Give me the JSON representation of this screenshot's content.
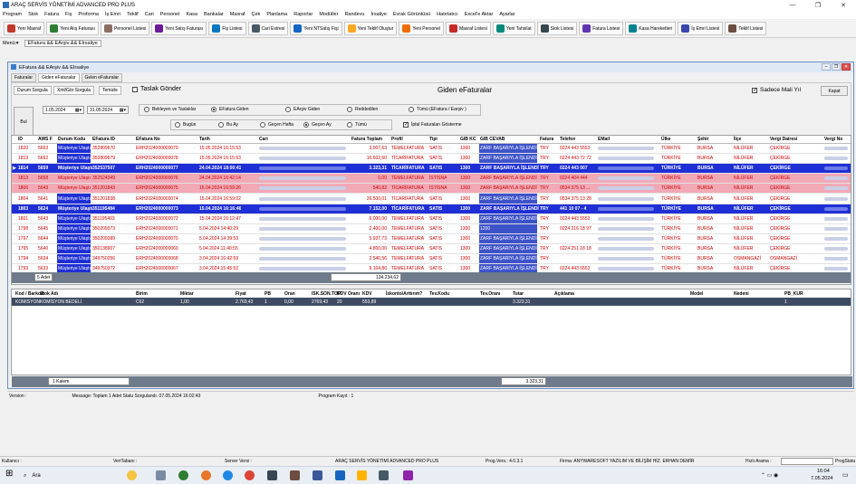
{
  "title": "ARAÇ SERVİS YÖNETİMİ ADVANCED PRO PLUS",
  "menu": [
    "Program",
    "Stok",
    "Fatura",
    "Fiş",
    "Proforma",
    "İş Emri",
    "Teklif",
    "Cari",
    "Personel",
    "Kasa",
    "Bankalar",
    "Masraf",
    "Çek",
    "Planlama",
    "Raporlar",
    "Modüller",
    "Randevu",
    "İrsaliye",
    "Evrak Görüntüsü",
    "Hatırlatıcı",
    "Excel'e Aktar",
    "Ayarlar"
  ],
  "toolbar": [
    {
      "label": "Yeni Masraf",
      "color": "#c0392b"
    },
    {
      "label": "Yeni Alış Faturası",
      "color": "#2e7d32"
    },
    {
      "label": "Personel Listesi",
      "color": "#8d6e63"
    },
    {
      "label": "Yeni Satış Faturası",
      "color": "#6a1b9a"
    },
    {
      "label": "Fiş Listesi",
      "color": "#0277bd"
    },
    {
      "label": "Cari Extresi",
      "color": "#455a64"
    },
    {
      "label": "Yeni NTSatış Fişi",
      "color": "#1565c0"
    },
    {
      "label": "Yeni Teklif Oluştur",
      "color": "#f9a825"
    },
    {
      "label": "Yeni Personel",
      "color": "#ef6c00"
    },
    {
      "label": "Masraf Listesi",
      "color": "#c62828"
    },
    {
      "label": "Yeni Tahsilat",
      "color": "#00897b"
    },
    {
      "label": "Stok Listesi",
      "color": "#37474f"
    },
    {
      "label": "Fatura Listesi",
      "color": "#5e35b1"
    },
    {
      "label": "Kasa Hareketleri",
      "color": "#00838f"
    },
    {
      "label": "İş Emri Listesi",
      "color": "#3949ab"
    },
    {
      "label": "Teklif Listesi",
      "color": "#6d4c41"
    }
  ],
  "subbar": {
    "menu": "Menü",
    "tab": "EFatura && EArşiv && EIrsaliye"
  },
  "window": {
    "title": "EFatura && EArşiv && EIrsaliye",
    "tabs": [
      "Faturalar",
      "Giden eFaturalar",
      "Gelen eFaturalar"
    ],
    "panel_tabs": [
      "Durum Sorgula",
      "Xml/Gör Sorgula",
      "Temizle"
    ],
    "taslak": "Taslak Gönder",
    "heading": "Giden eFaturalar",
    "sadece": "Sadece Mali Yıl",
    "kapat": "Kapat",
    "bul": "Bul",
    "date_from": "1.05.2024",
    "date_to": "31.05.2024",
    "radios1": [
      "Bekleyen ve Taslaklar",
      "EFatura Giden",
      "EArşiv Giden",
      "Reddedilen",
      "Tümü (EFatura / Earşiv )"
    ],
    "radios2": [
      "Bugün",
      "Bu Ay",
      "Geçen Hafta",
      "Geçen Ay",
      "Tümü"
    ],
    "iptal": "İptal Faturaları Gösterme"
  },
  "grid": {
    "columns": [
      "ID",
      "AWS F",
      "Durum Kodu",
      "EFatura ID",
      "EFatura No",
      "Tarih",
      "Cari",
      "Fatura Toplam",
      "Profil",
      "Tipi",
      "GIB KC",
      "GIB CEVAB",
      "Fatura",
      "Telefon",
      "EMail",
      "Ülke",
      "Şehir",
      "İlçe",
      "Vergi Dairesi",
      "Vergi No"
    ],
    "rows": [
      {
        "id": "1820",
        "aws": "5663",
        "durum": "Müşteriye Ulaştı",
        "efid": "352809670",
        "no": "ERH2024000000079",
        "tarih": "15.05.2024 16:15:53",
        "toplam": "3.007,63",
        "profil": "TEMELFATURA",
        "tipi": "SATIS",
        "gib": "1300",
        "cevap": "ZARF BAŞARIYLA İŞLENDİ",
        "fatura": "TRY",
        "tel": "0224 443 5553",
        "ulke": "TÜRKİYE",
        "sehir": "BURSA",
        "ilce": "NİLÜFER",
        "vd": "ÇEKİRGE",
        "style": "normal"
      },
      {
        "id": "1819",
        "aws": "5662",
        "durum": "Müşteriye Ulaştı",
        "efid": "352809679",
        "no": "ERH2024000000078",
        "tarih": "15.05.2024 16:15:53",
        "toplam": "16.602,60",
        "profil": "TİCARİFATURA",
        "tipi": "SATIS",
        "gib": "1300",
        "cevap": "ZARF BAŞARIYLA İŞLENDİ",
        "fatura": "TRY",
        "tel": "0224 443 72 72",
        "ulke": "TÜRKİYE",
        "sehir": "BURSA",
        "ilce": "NİLÜFER",
        "vd": "ÇEKİRGE",
        "style": "normal"
      },
      {
        "id": "1814",
        "aws": "5659",
        "durum": "Müşteriye Ulaştı",
        "efid": "352537507",
        "no": "ERH2024000000077",
        "tarih": "24.04.2024 18:00:41",
        "toplam": "3.323,31",
        "profil": "TİCARİFATURA",
        "tipi": "SATIS",
        "gib": "1300",
        "cevap": "ZARF BAŞARIYLA İŞLENDİ",
        "fatura": "TRY",
        "tel": "0224 443 007",
        "ulke": "TÜRKİYE",
        "sehir": "BURSA",
        "ilce": "NİLÜFER",
        "vd": "ÇEKİRGE",
        "style": "blue"
      },
      {
        "id": "1813",
        "aws": "5658",
        "durum": "Müşteriye Ulaştı",
        "efid": "352524349",
        "no": "ERH2024000000076",
        "tarih": "24.04.2024 16:42:14",
        "toplam": "0,00",
        "profil": "TEMELFATURA",
        "tipi": "İSTİSNA",
        "gib": "1300",
        "cevap": "ZARF BAŞARIYLA İŞLENDİ",
        "fatura": "TRY",
        "tel": "0224 404 444",
        "ulke": "TÜRKİYE",
        "sehir": "BURSA",
        "ilce": "NİLÜFER",
        "vd": "ÇEKİRGE",
        "style": "pink"
      },
      {
        "id": "1806",
        "aws": "5643",
        "durum": "Müşteriye Ulaştı",
        "efid": "351201843",
        "no": "ERH2024000000075",
        "tarih": "15.04.2024 16:59:26",
        "toplam": "540,82",
        "profil": "TİCARİFATURA",
        "tipi": "İSTİSNA",
        "gib": "1300",
        "cevap": "ZARF BAŞARIYLA İŞLENDİ",
        "fatura": "TRY",
        "tel": "0534 375 13 ...",
        "ulke": "TÜRKİYE",
        "sehir": "BURSA",
        "ilce": "NİLÜFER",
        "vd": "ÇEKİRGE",
        "style": "pink"
      },
      {
        "id": "1804",
        "aws": "5641",
        "durum": "Müşteriye Ulaştı",
        "efid": "351201838",
        "no": "ERH2024000000074",
        "tarih": "15.04.2024 16:59:02",
        "toplam": "26.500,01",
        "profil": "TİCARİFATURA",
        "tipi": "SATIS",
        "gib": "1300",
        "cevap": "ZARF BAŞARIYLA İŞLENDİ",
        "fatura": "TRY",
        "tel": "0534 375 13 28",
        "ulke": "TÜRKİYE",
        "sehir": "BURSA",
        "ilce": "NİLÜFER",
        "vd": "ÇEKİRGE",
        "style": "normal"
      },
      {
        "id": "1803",
        "aws": "5624",
        "durum": "Müşteriye Ulaştı",
        "efid": "351195484",
        "no": "ERH2024000000073",
        "tarih": "15.04.2024 16:16:46",
        "toplam": "7.152,00",
        "profil": "TİCARİFATURA",
        "tipi": "SATIS",
        "gib": "1300",
        "cevap": "ZARF BAŞARIYLA İŞLENDİ",
        "fatura": "TRY",
        "tel": "441 10 07 - 4",
        "ulke": "TÜRKİYE",
        "sehir": "BURSA",
        "ilce": "NİLÜFER",
        "vd": "ÇEKİRGE",
        "style": "blue"
      },
      {
        "id": "1801",
        "aws": "5643",
        "durum": "Müşteriye Ulaştı",
        "efid": "351195493",
        "no": "ERH2024000000072",
        "tarih": "15.04.2024 16:12:47",
        "toplam": "6.000,00",
        "profil": "TEMELFATURA",
        "tipi": "SATIS",
        "gib": "1300",
        "cevap": "ZARF BAŞARIYLA İŞLENDİ",
        "fatura": "TRY",
        "tel": "0224 443 5553",
        "ulke": "TÜRKİYE",
        "sehir": "BURSA",
        "ilce": "NİLÜFER",
        "vd": "ÇEKİRGE",
        "style": "normal"
      },
      {
        "id": "1798",
        "aws": "5645",
        "durum": "Müşteriye Ulaştı",
        "efid": "350209373",
        "no": "ERH2024000000071",
        "tarih": "5.04.2024 14:40:29",
        "toplam": "2.400,00",
        "profil": "TEMELFATURA",
        "tipi": "SATIS",
        "gib": "1300",
        "cevap": "1200",
        "fatura": "TRY",
        "tel": "0224 216 18 97",
        "ulke": "TÜRKİYE",
        "sehir": "BURSA",
        "ilce": "NİLÜFER",
        "vd": "ÇEKİRGE",
        "style": "normal"
      },
      {
        "id": "1797",
        "aws": "5644",
        "durum": "Müşteriye Ulaştı",
        "efid": "350209389",
        "no": "ERH2024000000070",
        "tarih": "5.04.2024 14:39:53",
        "toplam": "5.937,73",
        "profil": "TEMELFATURA",
        "tipi": "SATIS",
        "gib": "1300",
        "cevap": "ZARF BAŞARIYLA İŞLENDİ",
        "fatura": "TRY",
        "tel": "",
        "ulke": "TÜRKİYE",
        "sehir": "BURSA",
        "ilce": "NİLÜFER",
        "vd": "ÇEKİRGE",
        "style": "normal"
      },
      {
        "id": "1795",
        "aws": "5640",
        "durum": "Müşteriye Ulaştı",
        "efid": "350138907",
        "no": "ERH2024000000069",
        "tarih": "5.04.2024 11:40:55",
        "toplam": "4.800,00",
        "profil": "TEMELFATURA",
        "tipi": "SATIS",
        "gib": "1300",
        "cevap": "ZARF BAŞARIYLA İŞLENDİ",
        "fatura": "TRY",
        "tel": "0224 251 18 18",
        "ulke": "TÜRKİYE",
        "sehir": "BURSA",
        "ilce": "NİLÜFER",
        "vd": "ÇEKİRGE",
        "style": "normal"
      },
      {
        "id": "1794",
        "aws": "5634",
        "durum": "Müşteriye Ulaştı",
        "efid": "349750256",
        "no": "ERH2024000000068",
        "tarih": "3.04.2024 16:42:59",
        "toplam": "2.540,56",
        "profil": "TEMELFATURA",
        "tipi": "SATIS",
        "gib": "1300",
        "cevap": "ZARF BAŞARIYLA İŞLENDİ",
        "fatura": "TRY",
        "tel": "",
        "ulke": "TÜRKİYE",
        "sehir": "BURSA",
        "ilce": "OSMANGAZİ",
        "vd": "OSMANGAZİ",
        "style": "normal"
      },
      {
        "id": "1793",
        "aws": "5633",
        "durum": "Müşteriye Ulaştı",
        "efid": "349750372",
        "no": "ERH2024000000067",
        "tarih": "3.04.2024 15:45:52",
        "toplam": "9.104,86",
        "profil": "TEMELFATURA",
        "tipi": "SATIS",
        "gib": "1300",
        "cevap": "ZARF BAŞARIYLA İŞLENDİ",
        "fatura": "TRY",
        "tel": "0224 443 5553",
        "ulke": "TÜRKİYE",
        "sehir": "BURSA",
        "ilce": "NİLÜFER",
        "vd": "ÇEKİRGE",
        "style": "normal"
      }
    ],
    "count": "5 Adet",
    "sum": "134.234,62"
  },
  "detail": {
    "columns": [
      "Kod / Barkod",
      "Stok Adı",
      "Birim",
      "Miktar",
      "Fiyat",
      "PB",
      "Oran",
      "ISK.SON.TOP",
      "KDV Oranı",
      "KDV",
      "İskonto/Arttırım?",
      "Tev.Kodu",
      "Tev.Oranı",
      "Tutar",
      "Açıklama",
      "Model",
      "Nedeni",
      "PB_KUR"
    ],
    "row": {
      "kod": "KOMISYON",
      "stok": "KOMİSYON BEDELİ",
      "birim": "C62",
      "miktar": "1,00",
      "fiyat": "2.769,43",
      "pb": "1",
      "oran": "0,00",
      "isk": "2769,43",
      "kdvo": "20",
      "kdv": "553,89",
      "tutar": "3.323,31",
      "pbkur": "1"
    },
    "count": "1 Kalem",
    "sum": "3.323,31"
  },
  "version_bar": {
    "version": "Version :",
    "message": "Message:  Toplam 1 Adet Statu Sorgulandı. 07.05.2024 16:02:43",
    "total": "Program Kayıt : 1"
  },
  "statusbar": {
    "user": "Kullanıcı :",
    "db": "VeriTabanı :",
    "server": "Server Versi :",
    "app": "ARAÇ SERVİS YÖNETİMİ ADVANCED PRO PLUS",
    "ver": "Prog.Vers.: 4.0.3.1",
    "firm": "Firma:  ANYWARESOFT YAZILIM VE BİLİŞİM HİZ. ERHAN DEMİR",
    "search": "Hızlı Arama :",
    "status": "ProgStatu"
  },
  "taskbar": {
    "search": "Ara",
    "time": "16:04",
    "date": "7.05.2024"
  }
}
